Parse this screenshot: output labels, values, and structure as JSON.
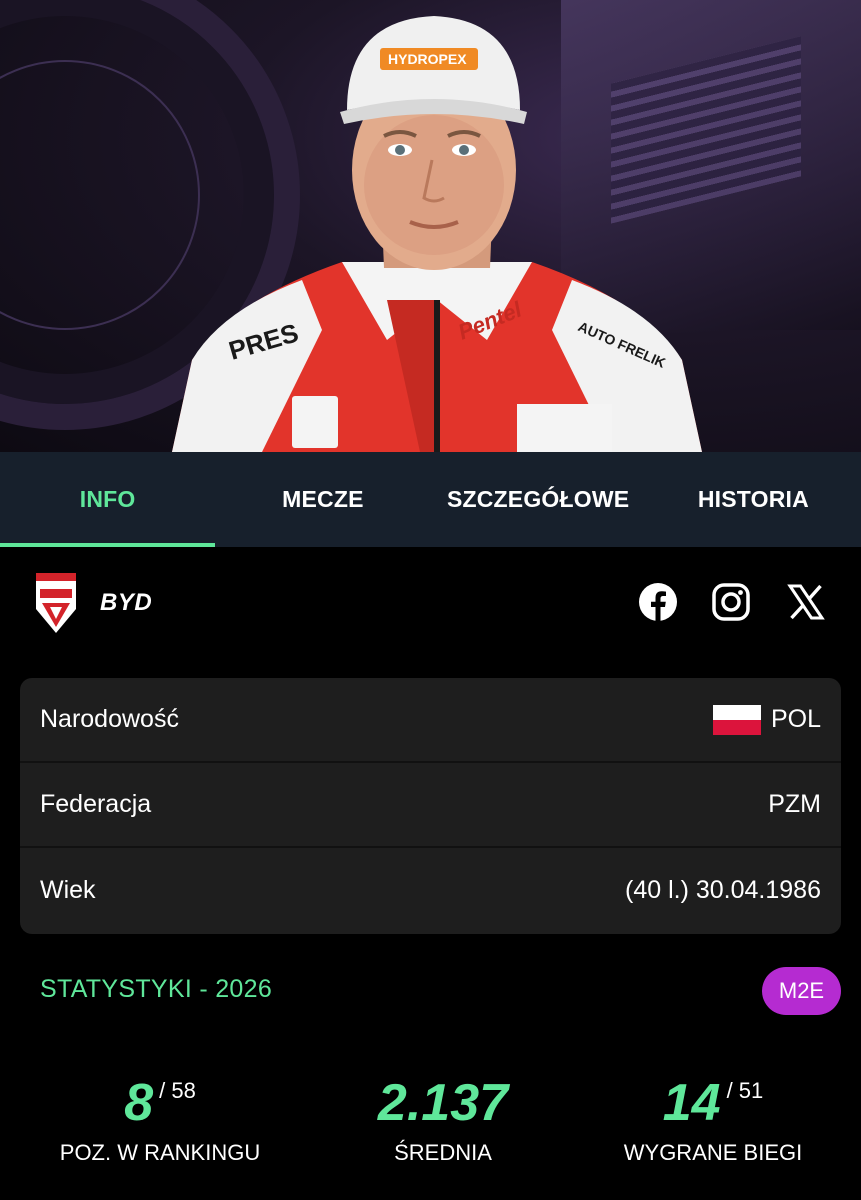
{
  "tabs": [
    {
      "label": "INFO",
      "active": true
    },
    {
      "label": "MECZE",
      "active": false
    },
    {
      "label": "SZCZEGÓŁOWE",
      "active": false
    },
    {
      "label": "HISTORIA",
      "active": false
    }
  ],
  "club": {
    "abbr": "BYD",
    "logo_icon": "polonia-bydgoszcz-logo"
  },
  "social": [
    "facebook-icon",
    "instagram-icon",
    "x-icon"
  ],
  "info": {
    "nationality": {
      "label": "Narodowość",
      "value": "POL",
      "flag": "poland-flag"
    },
    "federation": {
      "label": "Federacja",
      "value": "PZM"
    },
    "age": {
      "label": "Wiek",
      "value": "(40 l.) 30.04.1986"
    }
  },
  "stats": {
    "title": "STATYSTYKI - 2026",
    "league_badge": "M2E",
    "items": [
      {
        "value": "8",
        "total": "/ 58",
        "label": "POZ. W RANKINGU"
      },
      {
        "value": "2.137",
        "total": "",
        "label": "ŚREDNIA"
      },
      {
        "value": "14",
        "total": "/ 51",
        "label": "WYGRANE BIEGI"
      }
    ]
  },
  "colors": {
    "accent": "#5fe79a",
    "tabbar": "#17202c",
    "card": "#1e1e1e",
    "badge": "#b52bd1"
  }
}
